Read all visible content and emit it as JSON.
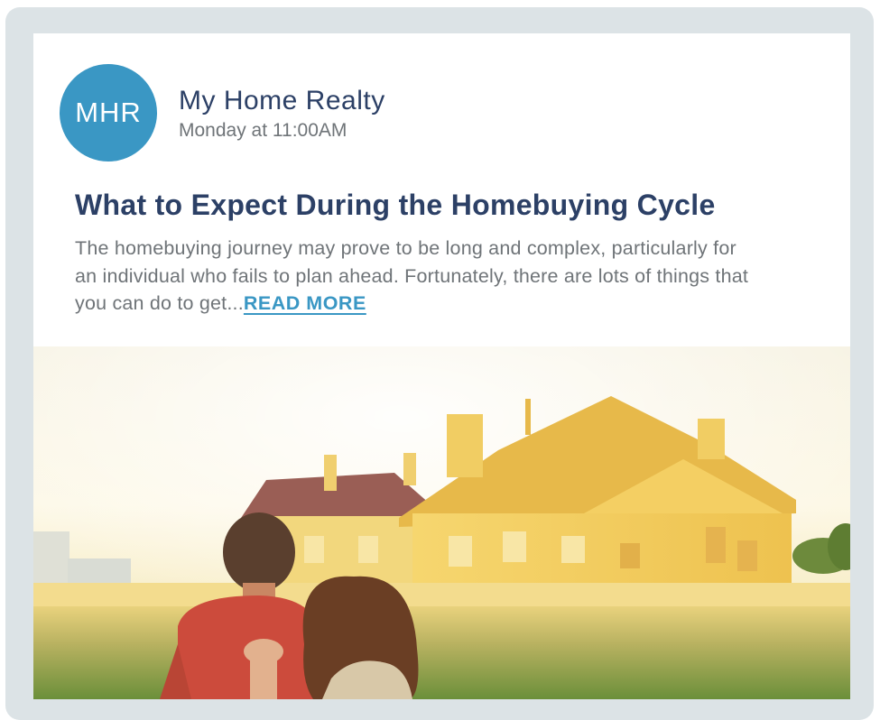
{
  "post": {
    "avatar_initials": "MHR",
    "author_name": "My Home Realty",
    "timestamp": "Monday at 11:00AM",
    "title": "What to Expect During the Homebuying Cycle",
    "excerpt": "The homebuying journey may prove to be long and complex, particularly for an individual who fails to plan ahead. Fortunately, there are lots of things that you can do to get...",
    "read_more_label": "READ MORE"
  },
  "colors": {
    "frame": "#dce3e6",
    "avatar": "#3a97c4",
    "title_text": "#2c4066",
    "body_text": "#6f7478",
    "link": "#3a97c4"
  }
}
